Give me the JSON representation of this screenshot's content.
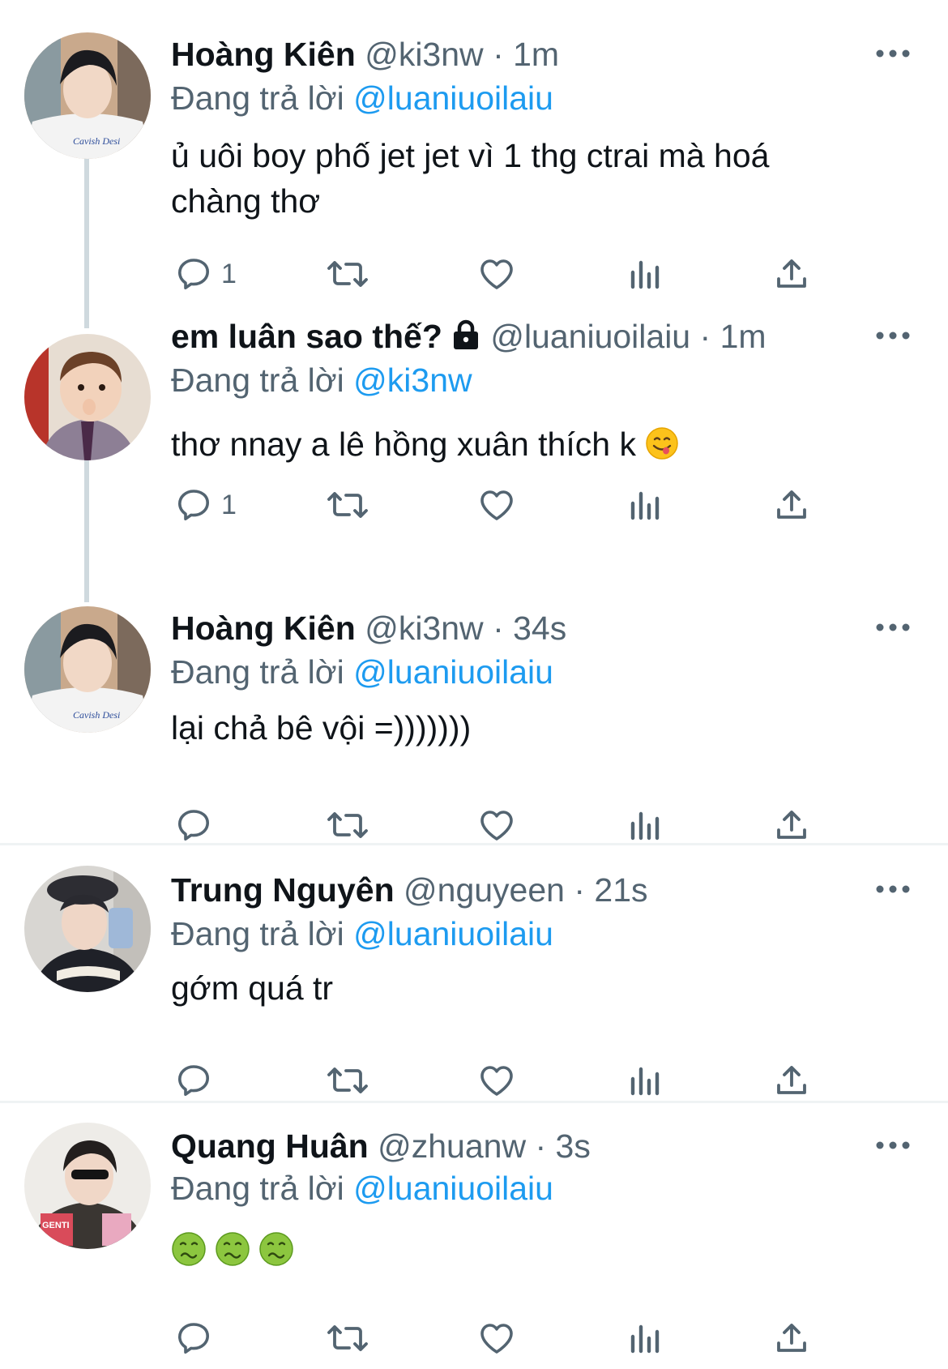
{
  "tweets": [
    {
      "name": "Hoàng Kiên",
      "handle": "@ki3nw",
      "dot": "·",
      "time": "1m",
      "reply_prefix": "Đang trả lời",
      "reply_to": "@luaniuoilaiu",
      "text_line1": "ủ uôi boy phố jet jet vì 1 thg ctrai mà hoá",
      "text_line2": "chàng thơ",
      "reply_count": "1",
      "avatar": "avatar-hoang-kien"
    },
    {
      "name": "em luân sao thế?",
      "handle": "@luaniuoilaiu",
      "dot": "·",
      "time": "1m",
      "protected_icon": "lock-icon",
      "reply_prefix": "Đang trả lời",
      "reply_to": "@ki3nw",
      "text": "thơ nnay a lê hồng xuân thích k",
      "text_emoji": "face-savoring-food-emoji",
      "reply_count": "1",
      "avatar": "avatar-em-luan"
    },
    {
      "name": "Hoàng Kiên",
      "handle": "@ki3nw",
      "dot": "·",
      "time": "34s",
      "reply_prefix": "Đang trả lời",
      "reply_to": "@luaniuoilaiu",
      "text": "lại chả bê vội =)))))))",
      "reply_count": "",
      "avatar": "avatar-hoang-kien"
    },
    {
      "name": "Trung Nguyên",
      "handle": "@nguyeen",
      "dot": "·",
      "time": "21s",
      "reply_prefix": "Đang trả lời",
      "reply_to": "@luaniuoilaiu",
      "text": "gớm quá tr",
      "reply_count": "",
      "avatar": "avatar-trung-nguyen"
    },
    {
      "name": "Quang Huân",
      "handle": "@zhuanw",
      "dot": "·",
      "time": "3s",
      "reply_prefix": "Đang trả lời",
      "reply_to": "@luaniuoilaiu",
      "text_emoji": "nauseated-face-emoji x3",
      "reply_count": "",
      "avatar": "avatar-quang-huan"
    }
  ],
  "icons": [
    "more-icon",
    "reply-icon",
    "retweet-icon",
    "like-icon",
    "views-icon",
    "share-icon"
  ],
  "colors": {
    "link": "#1d9bf0",
    "secondary": "#536471",
    "text": "#0f1419",
    "divider": "#eff3f4",
    "thread": "#cfd9de"
  }
}
